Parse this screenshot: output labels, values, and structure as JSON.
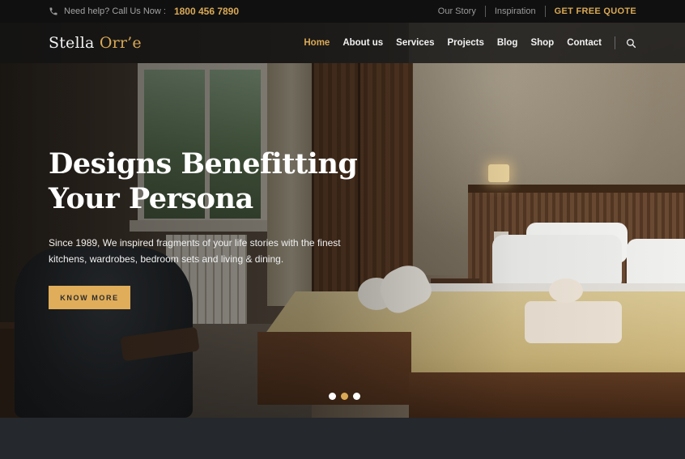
{
  "topbar": {
    "help_text": "Need help? Call Us Now :",
    "phone": "1800 456 7890",
    "links": [
      "Our Story",
      "Inspiration",
      "GET FREE QUOTE"
    ]
  },
  "brand": {
    "name_part1": "Stella ",
    "name_part2": "Orr’e"
  },
  "nav": {
    "items": [
      "Home",
      "About us",
      "Services",
      "Projects",
      "Blog",
      "Shop",
      "Contact"
    ],
    "active": "Home"
  },
  "hero": {
    "title_line1": "Designs Benefitting",
    "title_line2": "Your Persona",
    "description": "Since 1989, We inspired fragments of your life stories with the finest kitchens, wardrobes, bedroom sets and living & dining.",
    "cta_label": "KNOW MORE"
  },
  "slider": {
    "count": 3,
    "active_index": 1
  },
  "colors": {
    "accent": "#d9a955",
    "topbar_bg": "#101010",
    "bottom_strip": "#25282d"
  },
  "icons": {
    "phone": "phone-icon",
    "search": "search-icon"
  }
}
